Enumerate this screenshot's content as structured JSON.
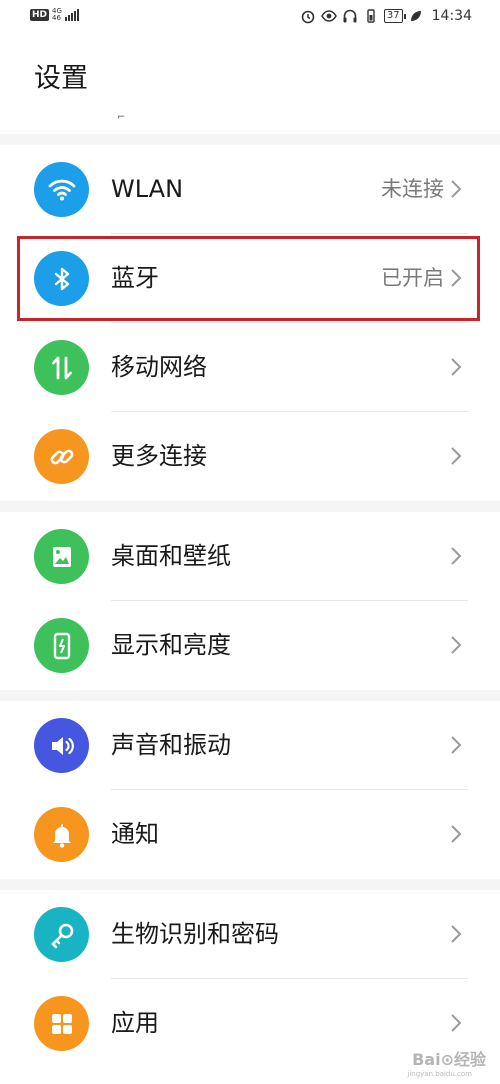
{
  "status_bar": {
    "hd": "HD",
    "network_top": "4G",
    "network_bottom": "46",
    "battery": "37",
    "time": "14:34"
  },
  "header": {
    "title": "设置",
    "peek_text": "⌐"
  },
  "colors": {
    "wlan": "#1c9fe8",
    "bluetooth": "#1c9fe8",
    "mobile": "#3ec15b",
    "more": "#f7961e",
    "wallpaper": "#3ec15b",
    "display": "#3ec15b",
    "sound": "#4557e0",
    "notification": "#f7961e",
    "biometric": "#19b4c4",
    "apps": "#f7961e",
    "highlight": "#c8252b"
  },
  "groups": [
    {
      "items": [
        {
          "label": "WLAN",
          "status": "未连接",
          "icon": "wifi-icon"
        },
        {
          "label": "蓝牙",
          "status": "已开启",
          "icon": "bluetooth-icon"
        },
        {
          "label": "移动网络",
          "status": "",
          "icon": "mobile-data-icon"
        },
        {
          "label": "更多连接",
          "status": "",
          "icon": "link-icon"
        }
      ]
    },
    {
      "items": [
        {
          "label": "桌面和壁纸",
          "status": "",
          "icon": "wallpaper-icon"
        },
        {
          "label": "显示和亮度",
          "status": "",
          "icon": "display-icon"
        }
      ]
    },
    {
      "items": [
        {
          "label": "声音和振动",
          "status": "",
          "icon": "speaker-icon"
        },
        {
          "label": "通知",
          "status": "",
          "icon": "bell-icon"
        }
      ]
    },
    {
      "items": [
        {
          "label": "生物识别和密码",
          "status": "",
          "icon": "key-icon"
        },
        {
          "label": "应用",
          "status": "",
          "icon": "apps-grid-icon"
        }
      ]
    }
  ],
  "watermark": {
    "text": "Bai⊙经验",
    "sub": "jingyan.baidu.com"
  }
}
